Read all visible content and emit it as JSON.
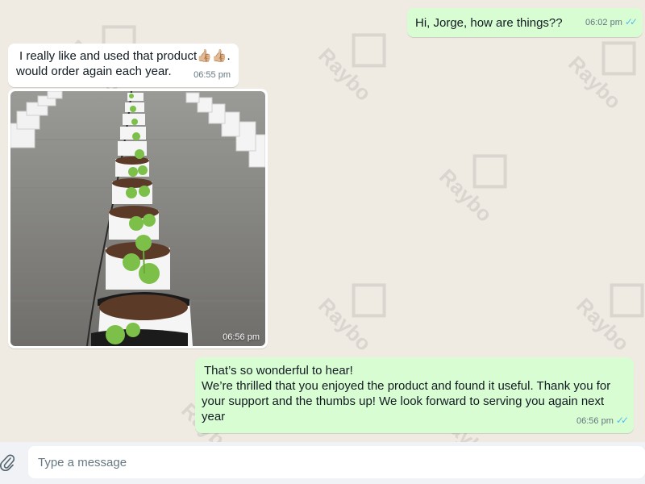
{
  "composer": {
    "placeholder": "Type a message",
    "attach_icon": "paperclip-icon"
  },
  "messages": [
    {
      "direction": "outgoing",
      "text": "Hi, Jorge, how are things??",
      "time": "06:02 pm",
      "status": "read"
    },
    {
      "direction": "incoming",
      "text_line1": "I really like and used that product👍🏼👍🏼.",
      "text_line2": "would order again each year.",
      "time": "06:55 pm"
    },
    {
      "direction": "incoming",
      "type": "image",
      "image_subject": "rows of grow bags with seedlings in a greenhouse",
      "time": "06:56 pm"
    },
    {
      "direction": "outgoing",
      "line1": "That’s so wonderful to hear!",
      "line2": "We’re thrilled that you enjoyed the product and found it useful. Thank you for your support and the thumbs up! We look forward to serving you again next year",
      "time": "06:56 pm",
      "status": "read"
    }
  ],
  "watermark_text": "Raybo",
  "colors": {
    "chat_bg": "#efeae2",
    "outgoing_bubble": "#d9fdd3",
    "incoming_bubble": "#ffffff",
    "read_ticks": "#53bdeb",
    "composer_bg": "#f0f2f5"
  }
}
